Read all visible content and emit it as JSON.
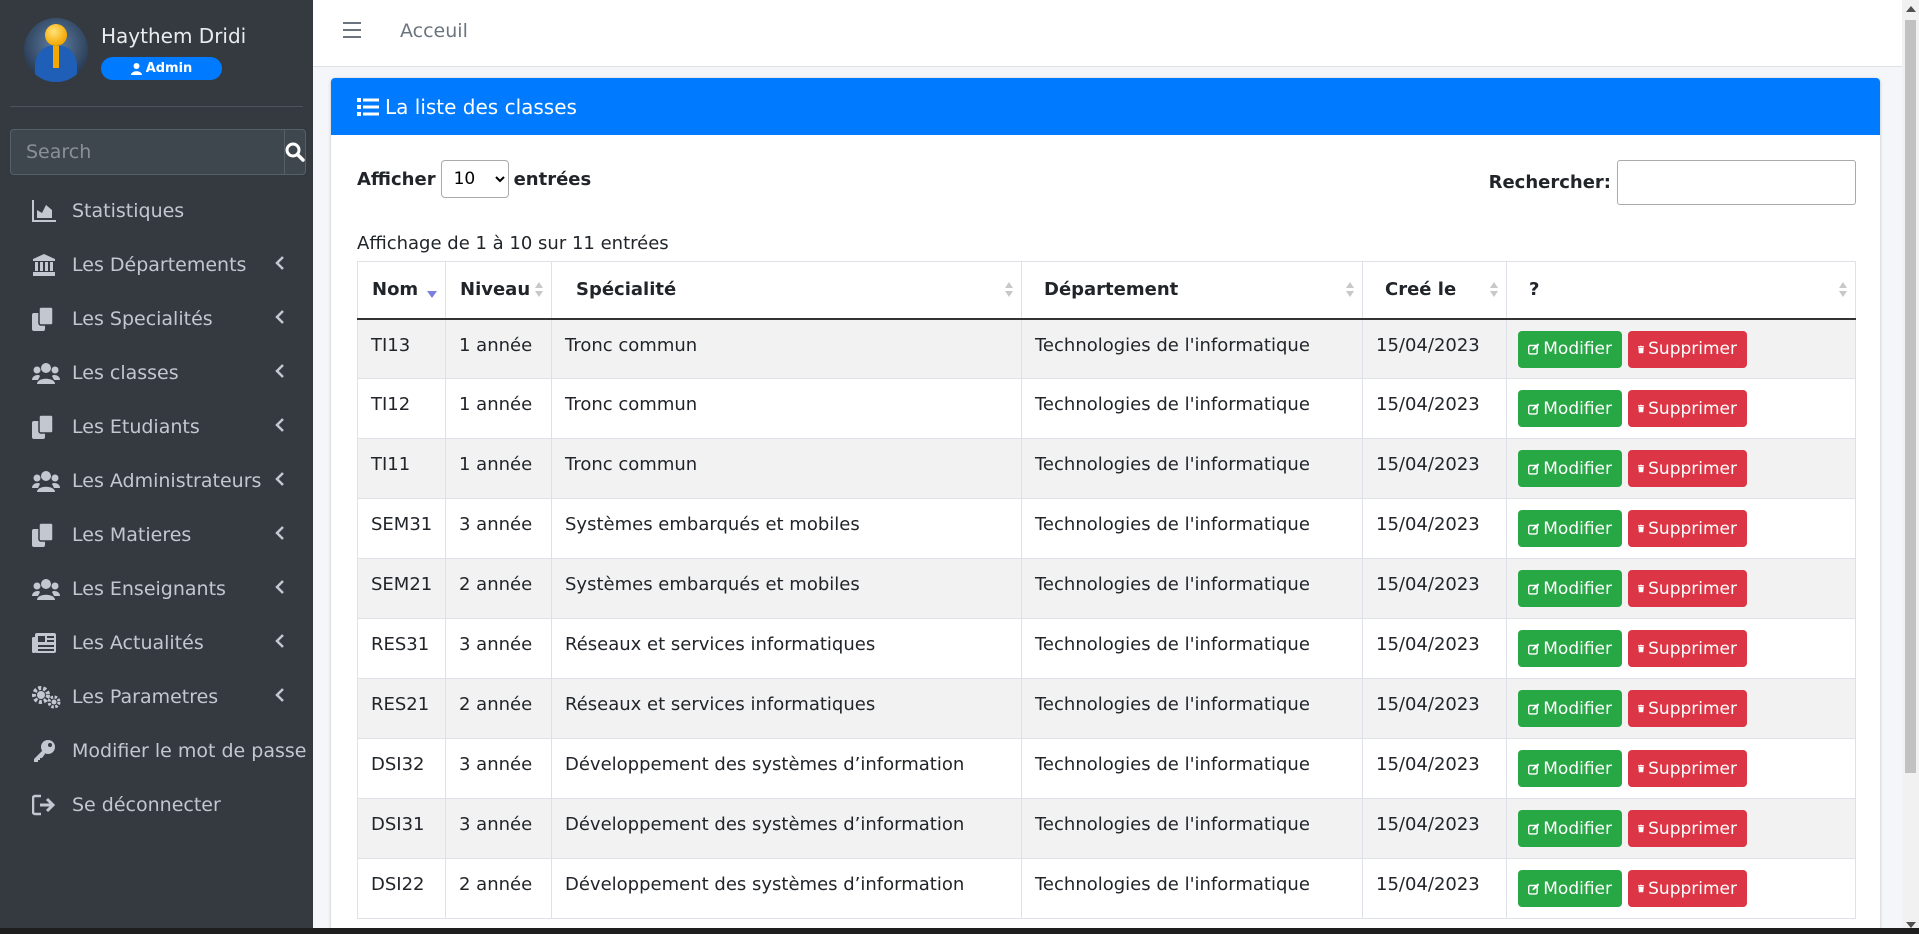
{
  "user": {
    "name": "Haythem Dridi",
    "role": "Admin"
  },
  "sidebar": {
    "search_placeholder": "Search",
    "items": [
      {
        "label": "Statistiques",
        "icon": "chart-area-icon",
        "has_submenu": false
      },
      {
        "label": "Les Départements",
        "icon": "university-icon",
        "has_submenu": true
      },
      {
        "label": "Les Specialités",
        "icon": "copy-icon",
        "has_submenu": true
      },
      {
        "label": "Les classes",
        "icon": "users-icon",
        "has_submenu": true
      },
      {
        "label": "Les Etudiants",
        "icon": "copy-icon",
        "has_submenu": true
      },
      {
        "label": "Les Administrateurs",
        "icon": "users-icon",
        "has_submenu": true
      },
      {
        "label": "Les Matieres",
        "icon": "copy-icon",
        "has_submenu": true
      },
      {
        "label": "Les Enseignants",
        "icon": "users-icon",
        "has_submenu": true
      },
      {
        "label": "Les Actualités",
        "icon": "newspaper-icon",
        "has_submenu": true
      },
      {
        "label": "Les Parametres",
        "icon": "cogs-icon",
        "has_submenu": true
      },
      {
        "label": "Modifier le mot de passe",
        "icon": "key-icon",
        "has_submenu": false
      },
      {
        "label": "Se déconnecter",
        "icon": "sign-out-icon",
        "has_submenu": false
      }
    ]
  },
  "topbar": {
    "breadcrumb": "Acceuil"
  },
  "card": {
    "title": "La liste des classes",
    "length_label_before": "Afficher",
    "length_value": "10",
    "length_label_after": "entrées",
    "filter_label": "Rechercher:",
    "info": "Affichage de 1 à 10 sur 11 entrées"
  },
  "table": {
    "columns": [
      "Nom",
      "Niveau",
      "Spécialité",
      "Département",
      "Creé le",
      "?"
    ],
    "edit_label": "Modifier",
    "delete_label": "Supprimer",
    "rows": [
      {
        "nom": "TI13",
        "niveau": "1 année",
        "specialite": "Tronc commun",
        "departement": "Technologies de l'informatique",
        "cree": "15/04/2023"
      },
      {
        "nom": "TI12",
        "niveau": "1 année",
        "specialite": "Tronc commun",
        "departement": "Technologies de l'informatique",
        "cree": "15/04/2023"
      },
      {
        "nom": "TI11",
        "niveau": "1 année",
        "specialite": "Tronc commun",
        "departement": "Technologies de l'informatique",
        "cree": "15/04/2023"
      },
      {
        "nom": "SEM31",
        "niveau": "3 année",
        "specialite": "Systèmes embarqués et mobiles",
        "departement": "Technologies de l'informatique",
        "cree": "15/04/2023"
      },
      {
        "nom": "SEM21",
        "niveau": "2 année",
        "specialite": "Systèmes embarqués et mobiles",
        "departement": "Technologies de l'informatique",
        "cree": "15/04/2023"
      },
      {
        "nom": "RES31",
        "niveau": "3 année",
        "specialite": "Réseaux et services informatiques",
        "departement": "Technologies de l'informatique",
        "cree": "15/04/2023"
      },
      {
        "nom": "RES21",
        "niveau": "2 année",
        "specialite": "Réseaux et services informatiques",
        "departement": "Technologies de l'informatique",
        "cree": "15/04/2023"
      },
      {
        "nom": "DSI32",
        "niveau": "3 année",
        "specialite": "Développement des systèmes d’information",
        "departement": "Technologies de l'informatique",
        "cree": "15/04/2023"
      },
      {
        "nom": "DSI31",
        "niveau": "3 année",
        "specialite": "Développement des systèmes d’information",
        "departement": "Technologies de l'informatique",
        "cree": "15/04/2023"
      },
      {
        "nom": "DSI22",
        "niveau": "2 année",
        "specialite": "Développement des systèmes d’information",
        "departement": "Technologies de l'informatique",
        "cree": "15/04/2023"
      }
    ]
  },
  "colors": {
    "primary": "#007bff",
    "success": "#28a745",
    "danger": "#dc3545",
    "sidebar": "#343a40"
  }
}
